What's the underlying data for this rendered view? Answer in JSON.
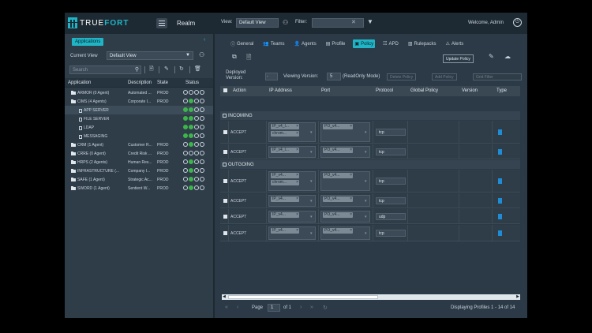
{
  "header": {
    "logo_text_1": "TRUE",
    "logo_text_2": "FORT",
    "realm": "Realm",
    "view_label": "View:",
    "view_value": "Default View",
    "filter_label": "Filter:",
    "welcome": "Welcome, Admin"
  },
  "left": {
    "title": "Applications",
    "current_view_label": "Current View",
    "current_view_value": "Default View",
    "search_placeholder": "Search",
    "columns": {
      "application": "Application",
      "description": "Description",
      "state": "State",
      "status": "Status"
    },
    "rows": [
      {
        "name": "ARMOR (0 Agent)",
        "desc": "Automated ...",
        "state": "PROD",
        "indent": 0,
        "type": "folder",
        "dots": [
          "empty",
          "empty",
          "empty",
          "empty"
        ]
      },
      {
        "name": "CIMS (4 Agents)",
        "desc": "Corporate I...",
        "state": "PROD",
        "indent": 0,
        "type": "folder",
        "dots": [
          "empty",
          "green",
          "empty",
          "empty"
        ]
      },
      {
        "name": "APP SERVER",
        "desc": "",
        "state": "",
        "indent": 1,
        "type": "file",
        "selected": true,
        "dots": [
          "green",
          "green",
          "empty",
          "empty"
        ]
      },
      {
        "name": "FILE SERVER",
        "desc": "",
        "state": "",
        "indent": 1,
        "type": "file",
        "dots": [
          "green",
          "green",
          "empty",
          "empty"
        ]
      },
      {
        "name": "LDAP",
        "desc": "",
        "state": "",
        "indent": 1,
        "type": "file",
        "dots": [
          "green",
          "green",
          "empty",
          "empty"
        ]
      },
      {
        "name": "MESSAGING",
        "desc": "",
        "state": "",
        "indent": 1,
        "type": "file",
        "dots": [
          "green",
          "green",
          "empty",
          "empty"
        ]
      },
      {
        "name": "CRM (1 Agent)",
        "desc": "Customer R...",
        "state": "PROD",
        "indent": 0,
        "type": "folder",
        "dots": [
          "empty",
          "green",
          "empty",
          "empty"
        ]
      },
      {
        "name": "CRRE (0 Agent)",
        "desc": "Credit Risk ...",
        "state": "PROD",
        "indent": 0,
        "type": "folder",
        "dots": [
          "empty",
          "empty",
          "empty",
          "empty"
        ]
      },
      {
        "name": "HRPS (2 Agents)",
        "desc": "Human Res...",
        "state": "PROD",
        "indent": 0,
        "type": "folder",
        "dots": [
          "empty",
          "green",
          "empty",
          "empty"
        ]
      },
      {
        "name": "INFRASTRUCTURE (...",
        "desc": "Company I...",
        "state": "PROD",
        "indent": 0,
        "type": "folder",
        "dots": [
          "empty",
          "green",
          "empty",
          "empty"
        ]
      },
      {
        "name": "SAFE (1 Agent)",
        "desc": "Strategic Ac...",
        "state": "PROD",
        "indent": 0,
        "type": "folder",
        "dots": [
          "empty",
          "green",
          "empty",
          "empty"
        ]
      },
      {
        "name": "SWORD (1 Agent)",
        "desc": "Sentient W...",
        "state": "PROD",
        "indent": 0,
        "type": "folder",
        "dots": [
          "empty",
          "green",
          "empty",
          "empty"
        ]
      }
    ]
  },
  "right": {
    "tabs": [
      {
        "label": "General",
        "icon": "info-icon"
      },
      {
        "label": "Teams",
        "icon": "teams-icon"
      },
      {
        "label": "Agents",
        "icon": "agents-icon"
      },
      {
        "label": "Profile",
        "icon": "profile-icon"
      },
      {
        "label": "Policy",
        "icon": "policy-icon",
        "active": true
      },
      {
        "label": "APD",
        "icon": "apd-icon"
      },
      {
        "label": "Rulepacks",
        "icon": "rulepacks-icon"
      },
      {
        "label": "Alerts",
        "icon": "alerts-icon"
      }
    ],
    "update_policy": "Update Policy",
    "deployed_version_label_1": "Deployed",
    "deployed_version_label_2": "Version:",
    "deployed_version_value": "-",
    "viewing_version_label": "Viewing Version:",
    "viewing_version_value": "5",
    "readonly_label": "(ReadOnly Mode)",
    "delete_policy": "Delete Policy",
    "add_policy": "Add Policy",
    "grid_filter_placeholder": "Grid Filter",
    "columns": {
      "action": "Action",
      "ip_address": "IP Address",
      "port": "Port",
      "protocol": "Protocol",
      "global_policy": "Global Policy",
      "version": "Version",
      "type": "Type"
    },
    "groups": {
      "incoming": "INCOMING",
      "outgoing": "OUTGOING"
    },
    "rows": [
      {
        "action": "ACCEPT",
        "ip": [
          "IP_v4_l...",
          "chrom..."
        ],
        "port": "PO_v4...",
        "protocol": "tcp"
      },
      {
        "action": "ACCEPT",
        "ip": [
          "IP_v4_l..."
        ],
        "port": "PO_v4...",
        "protocol": "tcp"
      },
      {
        "action": "ACCEPT",
        "ip": [
          "IP_v4...",
          "chrom..."
        ],
        "port": "PO_v4...",
        "protocol": "tcp"
      },
      {
        "action": "ACCEPT",
        "ip": [
          "IP_v4..."
        ],
        "port": "PO_v4...",
        "protocol": "tcp"
      },
      {
        "action": "ACCEPT",
        "ip": [
          "IP_v4..."
        ],
        "port": "PO_v4...",
        "protocol": "udp"
      },
      {
        "action": "ACCEPT",
        "ip": [
          "IP_v4..."
        ],
        "port": "PO_v4...",
        "protocol": "tcp"
      }
    ],
    "pager": {
      "page_label": "Page",
      "page_value": "1",
      "of_label": "of 1",
      "display": "Displaying Profiles 1 - 14 of 14"
    }
  },
  "colors": {
    "accent": "#1fb5c6",
    "status_green": "#3cb54a",
    "type_blue": "#1f8cd6"
  }
}
